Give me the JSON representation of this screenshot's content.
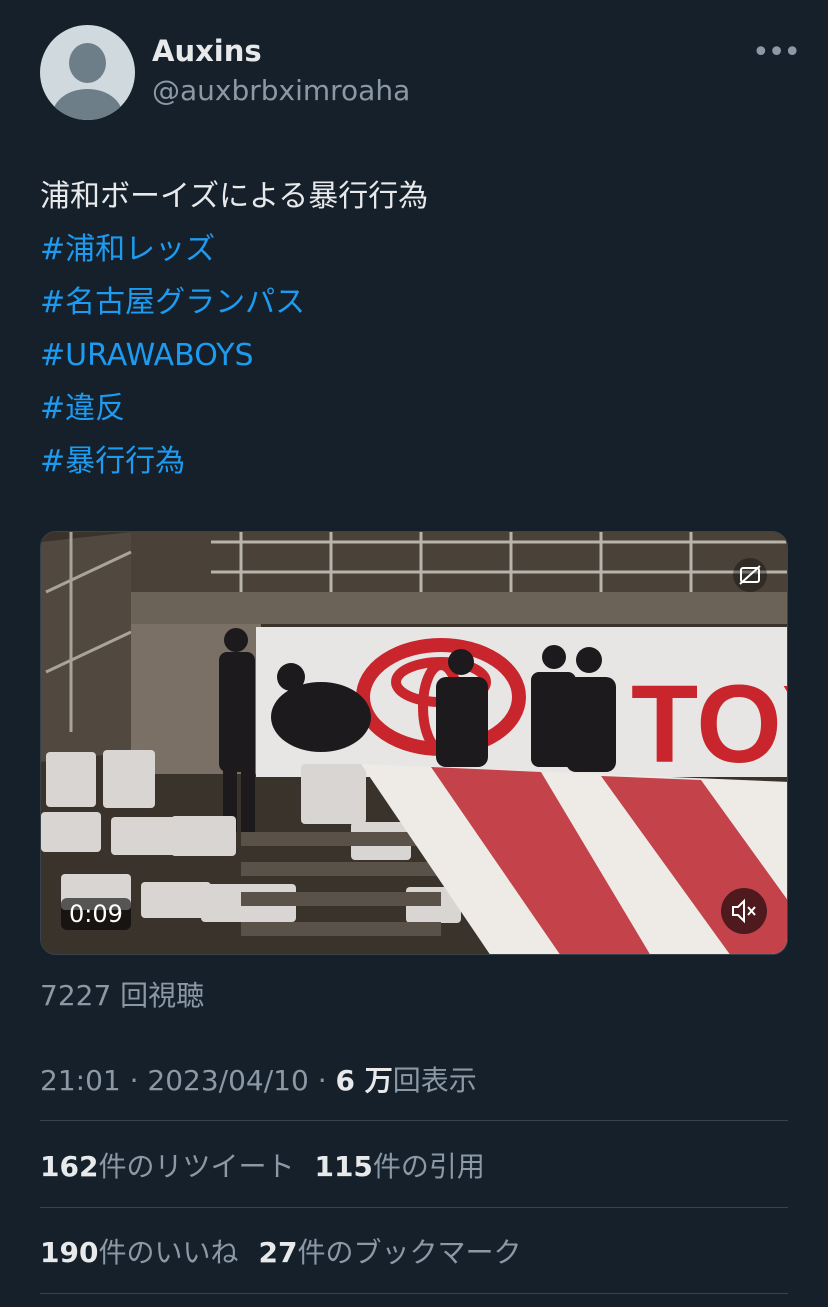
{
  "author": {
    "display_name": "Auxins",
    "handle": "@auxbrbximroaha",
    "more_icon": "more-horizontal-icon"
  },
  "tweet": {
    "text": "浦和ボーイズによる暴行行為",
    "hashtags": [
      "#浦和レッズ",
      "#名古屋グランパス",
      "#URAWABOYS",
      "#違反",
      "#暴行行為"
    ]
  },
  "media": {
    "duration": "0:09",
    "billboard_text": "TOY",
    "icons": {
      "captions": "closed-captions-icon",
      "mute": "muted-speaker-icon"
    }
  },
  "views_label": "7227 回視聴",
  "meta": {
    "time": "21:01",
    "date": "2023/04/10",
    "impressions_value": "6 万",
    "impressions_label": "回表示",
    "separator": "·"
  },
  "stats": {
    "retweets": "162",
    "retweets_label": "件のリツイート",
    "quotes": "115",
    "quotes_label": "件の引用",
    "likes": "190",
    "likes_label": "件のいいね",
    "bookmarks": "27",
    "bookmarks_label": "件のブックマーク"
  },
  "colors": {
    "background": "#15202b",
    "text": "#e7e9ea",
    "secondary": "#8b98a5",
    "link": "#1d9bf0",
    "divider": "#38444d"
  }
}
